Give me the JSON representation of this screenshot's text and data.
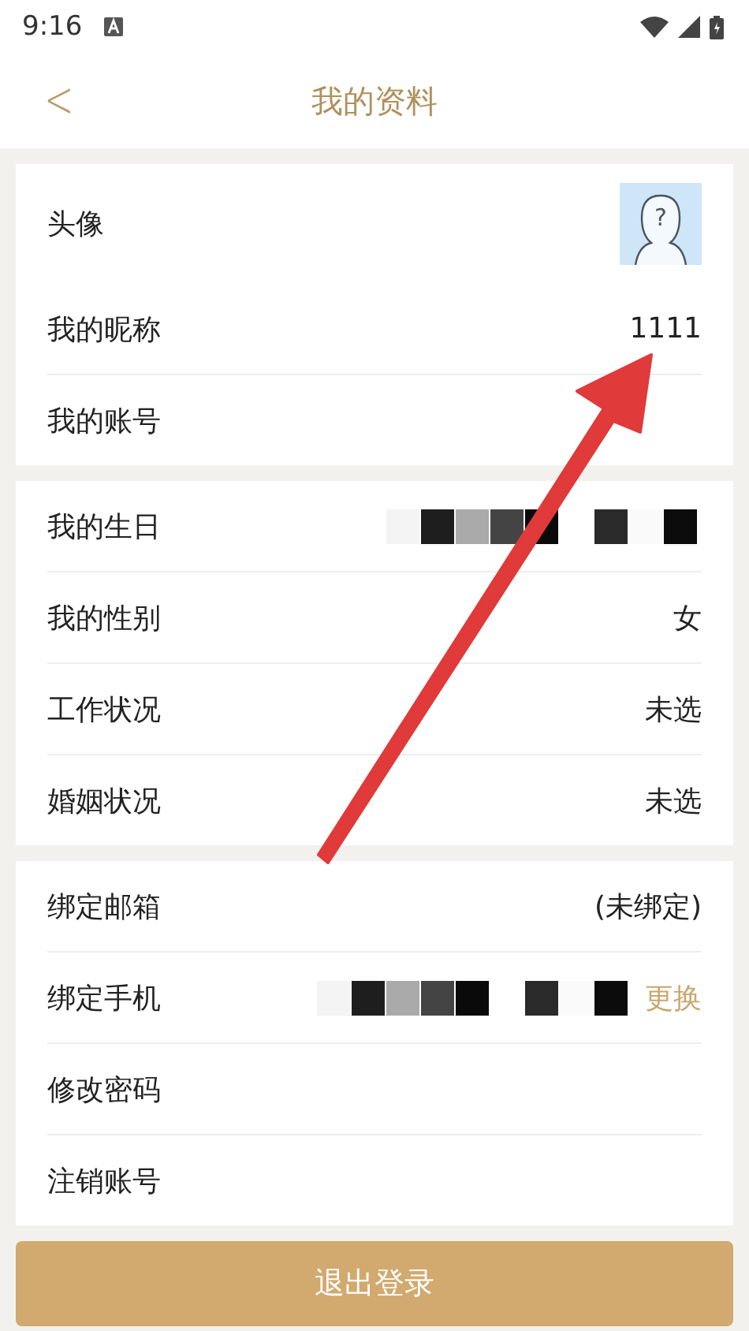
{
  "status_bar": {
    "time": "9:16"
  },
  "header": {
    "back": "<",
    "title": "我的资料"
  },
  "sections": [
    {
      "rows": [
        {
          "label": "头像",
          "kind": "avatar",
          "avatar_mark": "?"
        },
        {
          "label": "我的昵称",
          "kind": "text",
          "value": "1111"
        },
        {
          "label": "我的账号",
          "kind": "plain"
        }
      ]
    },
    {
      "rows": [
        {
          "label": "我的生日",
          "kind": "redacted"
        },
        {
          "label": "我的性别",
          "kind": "text",
          "value": "女"
        },
        {
          "label": "工作状况",
          "kind": "text",
          "value": "未选"
        },
        {
          "label": "婚姻状况",
          "kind": "text",
          "value": "未选"
        }
      ]
    },
    {
      "rows": [
        {
          "label": "绑定邮箱",
          "kind": "text",
          "value": "(未绑定)"
        },
        {
          "label": "绑定手机",
          "kind": "redacted",
          "action": "更换"
        },
        {
          "label": "修改密码",
          "kind": "plain"
        },
        {
          "label": "注销账号",
          "kind": "plain"
        }
      ]
    }
  ],
  "logout_button": "退出登录"
}
